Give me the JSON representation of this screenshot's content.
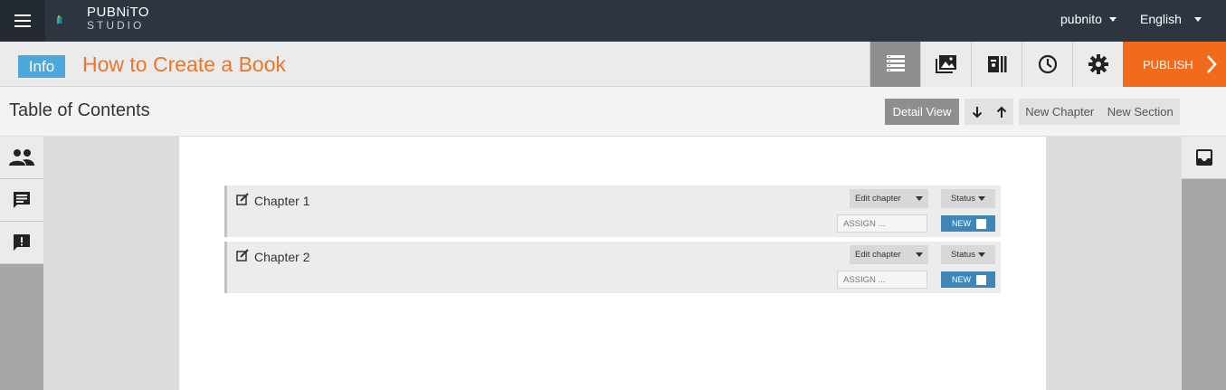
{
  "app": {
    "logo_line1": "PUBNiTO",
    "logo_line2": "STUDIO",
    "user": "pubnito",
    "language": "English"
  },
  "titlebar": {
    "info_label": "Info",
    "book_title": "How to Create a Book",
    "publish_label": "PUBLISH",
    "tools": [
      "list-icon",
      "images-icon",
      "library-icon",
      "clock-icon",
      "gear-icon"
    ]
  },
  "toc": {
    "title": "Table of Contents",
    "detail_view": "Detail View",
    "new_chapter": "New Chapter",
    "new_section": "New Section"
  },
  "chapters": [
    {
      "title": "Chapter 1",
      "edit_label": "Edit chapter",
      "status_label": "Status",
      "assign_placeholder": "ASSIGN ...",
      "badge": "NEW"
    },
    {
      "title": "Chapter 2",
      "edit_label": "Edit chapter",
      "status_label": "Status",
      "assign_placeholder": "ASSIGN ...",
      "badge": "NEW"
    }
  ],
  "colors": {
    "accent_orange": "#f26b1d",
    "title_orange": "#e8762c",
    "info_blue": "#4aa8dc",
    "badge_blue": "#3d86b6",
    "topbar": "#2d3640"
  }
}
